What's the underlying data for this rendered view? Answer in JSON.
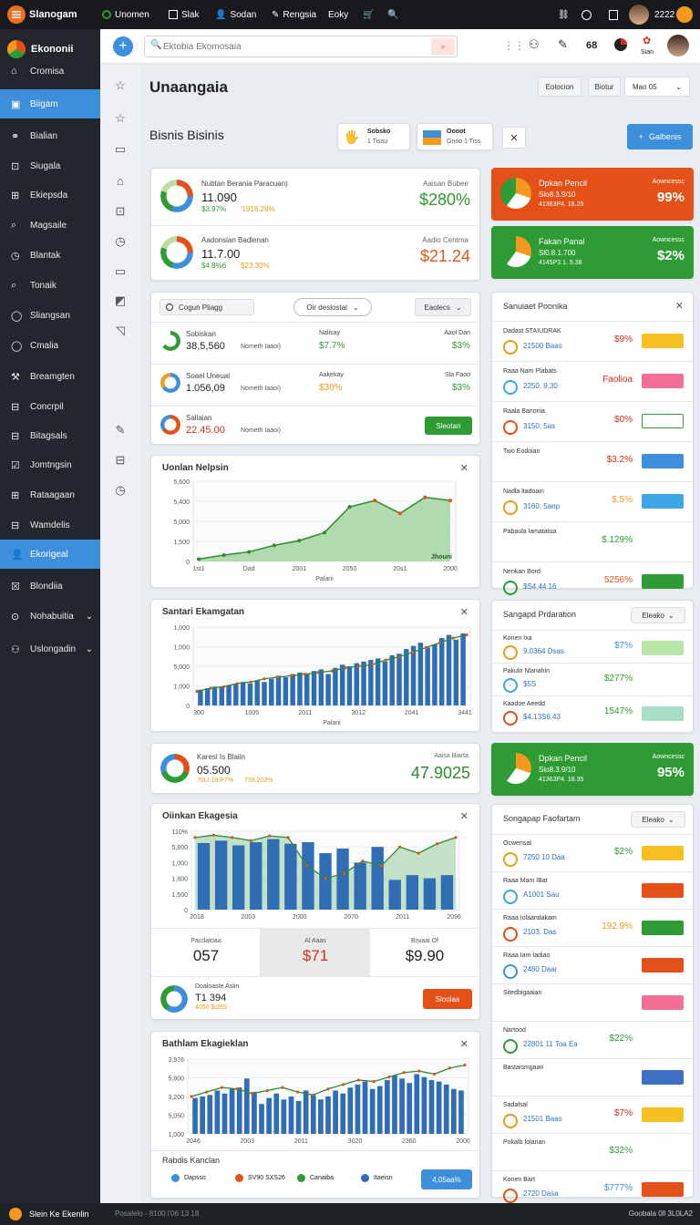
{
  "topbar": {
    "app": "Slanogam",
    "items": [
      "Unomen",
      "Slak",
      "Sodan",
      "Rengsia",
      "Eoky"
    ],
    "time": "2222"
  },
  "sidebar": {
    "brand": "Ekononii",
    "items": [
      "Cromisa",
      "Biigam",
      "Bialian",
      "Siugala",
      "Ekiepsda",
      "Magsaile",
      "Blantak",
      "Tonaik",
      "Sliangsan",
      "Cmalia",
      "Breamgten",
      "Concrpil",
      "Bitagsals",
      "Jomtngsin",
      "Rataagaan",
      "Wamdelis",
      "Ekorigeal",
      "Blondiia",
      "Nohabuitia",
      "Uslongadin"
    ]
  },
  "toolbar": {
    "search_placeholder": "Ektobia Ekomosaia",
    "badge": "68",
    "user": "Sian"
  },
  "header": {
    "title": "Unaangaia",
    "btn1": "Eolocion",
    "btn2": "Biotur",
    "select": "Mao 05"
  },
  "business": {
    "title": "Bisnis Bisinis",
    "chip1_title": "Sobsko",
    "chip1_sub": "1 Tissu",
    "chip2_title": "Oooot",
    "chip2_sub": "Gnoo 1 Tiss",
    "action": "Galbenis"
  },
  "stats": [
    {
      "title": "Nubtan Berania Paracuan)",
      "value": "11.090",
      "sub": "$3.97%",
      "sub2": "'1918.28%",
      "right_label": "Aaisan Bubee",
      "right_value": "$280%",
      "right_color": "#2e9b2e"
    },
    {
      "title": "Aadonsian Badlenan",
      "value": "11.7.00",
      "sub": "$4.8%6",
      "sub2": "$23.30%",
      "right_label": "Aadio Centma",
      "right_value": "$21.24",
      "right_color": "#e3581c"
    }
  ],
  "promo": [
    {
      "title": "Dpkan Pencil",
      "l2": "Slo8.3.9/10",
      "l3": "41363P4. 18.25",
      "label": "Aowncessc",
      "value": "99%",
      "color": "#e35018"
    },
    {
      "title": "Fakan Panal",
      "l2": "Sl0.8.1.700",
      "l3": "4145P3 1. 5.38",
      "label": "Aowncessc",
      "value": "$2%",
      "color": "#2e9b34"
    },
    {
      "title": "Dpkan Pencil",
      "l2": "Slo8.3.9/10",
      "l3": "41363P4. 18.35",
      "label": "Aowncessc",
      "value": "95%",
      "color": "#2e9b34"
    }
  ],
  "filters": {
    "search": "Cogun Pliagg",
    "select": "Oir deslostal",
    "btn": "Eaolecs"
  },
  "list1": [
    {
      "title": "Sobiskan",
      "value": "38,5,560",
      "mid": "Nometh Iaaoi)",
      "lab": "Nalisay",
      "v2": "$7.7%",
      "v2c": "#2e9b2e",
      "rl": "Aaol Dan",
      "rv": "$3%",
      "rc": "#2e9b2e"
    },
    {
      "title": "Soael Uneual",
      "value": "1.056,09",
      "mid": "Nometh Iaaoi)",
      "lab": "Aakekay",
      "v2": "$30%",
      "v2c": "#e89b16",
      "rl": "Sla Faoo",
      "rv": "$3%",
      "rc": "#2e9b2e"
    },
    {
      "title": "Sallaian",
      "value": "22.45.00",
      "mid": "Nometh Iaaoi)",
      "btn": "Sleotan"
    }
  ],
  "chart_data": [
    {
      "type": "area",
      "title": "Uonlan Nelpsin",
      "xlabel": "Palani",
      "ylabel": "",
      "x": [
        "1st1",
        "Dad",
        "2001",
        "2050",
        "20s1",
        "2000"
      ],
      "yticks": [
        "5,600",
        "5,400",
        "5,000",
        "1,500",
        "0"
      ],
      "values": [
        3,
        8,
        12,
        20,
        26,
        36,
        68,
        76,
        60,
        80,
        76
      ],
      "annotation": "Jhouni"
    },
    {
      "type": "bar",
      "title": "Santari Ekamgatan",
      "xlabel": "Palani",
      "ylabel": "",
      "x": [
        "300",
        "1005",
        "2011",
        "3012",
        "2041",
        "3441"
      ],
      "yticks": [
        "1,000",
        "1,000",
        "5,000",
        "1,000",
        "0"
      ],
      "values": [
        20,
        22,
        24,
        24,
        26,
        28,
        30,
        28,
        32,
        30,
        34,
        38,
        36,
        40,
        42,
        40,
        44,
        46,
        40,
        48,
        52,
        50,
        54,
        56,
        58,
        60,
        56,
        64,
        66,
        72,
        76,
        80,
        74,
        78,
        86,
        90,
        84,
        92
      ],
      "line": [
        18,
        22,
        24,
        28,
        30,
        34,
        36,
        38,
        40,
        42,
        44,
        48,
        50,
        52,
        58,
        62,
        68,
        74,
        80,
        86,
        90
      ]
    },
    {
      "type": "bar",
      "title": "Oiinkan Ekagesia",
      "xlabel": "",
      "ylabel": "",
      "x": [
        "2018",
        "2003",
        "2000",
        "2070",
        "2011",
        "2096"
      ],
      "yticks": [
        "110%",
        "5,800",
        "1,000",
        "1,800",
        "1,500",
        "0"
      ],
      "values": [
        85,
        88,
        82,
        86,
        90,
        84,
        86,
        72,
        78,
        60,
        80,
        38,
        44,
        40,
        44
      ],
      "line": [
        92,
        95,
        92,
        88,
        94,
        92,
        56,
        40,
        46,
        62,
        56,
        80,
        72,
        84,
        92
      ]
    },
    {
      "type": "bar",
      "title": "Bathlam Ekagieklan",
      "xlabel": "",
      "ylabel": "",
      "x": [
        "2046",
        "2003",
        "2011",
        "3020",
        "2360",
        "2000"
      ],
      "yticks": [
        "3,976",
        "5,800",
        "3,200",
        "5,050",
        "1,000"
      ],
      "values": [
        48,
        50,
        52,
        58,
        54,
        60,
        62,
        74,
        56,
        40,
        48,
        54,
        46,
        50,
        44,
        58,
        52,
        46,
        50,
        58,
        54,
        62,
        66,
        70,
        60,
        64,
        72,
        78,
        74,
        68,
        80,
        76,
        72,
        70,
        66,
        60,
        58
      ],
      "line": [
        50,
        56,
        62,
        60,
        54,
        58,
        62,
        56,
        52,
        60,
        66,
        72,
        70,
        76,
        82,
        84,
        80,
        88,
        92
      ]
    }
  ],
  "metric_single": {
    "title": "Karesl Is Blaiin",
    "value": "05.500",
    "sub": "70LI 18.P7%",
    "sub2": "739.202%",
    "right_label": "Aaisa Biarta",
    "right_value": "47.9025"
  },
  "kpis": [
    {
      "label": "Pacdatoaa",
      "value": "057",
      "color": "#222"
    },
    {
      "label": "Al Aaas",
      "value": "$71",
      "color": "#d92b1c"
    },
    {
      "label": "Bisiaai Of",
      "value": "$9.90",
      "color": "#222"
    }
  ],
  "kpi_footer": {
    "title": "Doaloaste Asiin",
    "value": "T1 394",
    "sub": "4050 $i28S",
    "btn": "Sloolaa"
  },
  "legend": {
    "title": "Rabdis Kanclan",
    "items": [
      "Dapsso",
      "SV90 SXS26",
      "Canaiba",
      "Itaeisn"
    ],
    "btn": "4,05aa%"
  },
  "panel1": {
    "title": "Sanuiaet Poonika",
    "rows": [
      {
        "t": "Dadast STAIUDRAK",
        "s": "21500 Baas",
        "v": "$9%",
        "vc": "#d92b1c",
        "pill": "#f5c021"
      },
      {
        "t": "Raaa  Nam Plabats",
        "s": "2250. 9.30",
        "v": "Faolioa",
        "vc": "#d92b1c",
        "pill": "#f26f95"
      },
      {
        "t": "Raala Banonia",
        "s": "3150. 5as",
        "v": "$0%",
        "vc": "#d92b1c",
        "pill": "#ffffff"
      },
      {
        "t": "Two Eodoian",
        "s": "",
        "v": "$3.2%",
        "vc": "#d92b1c",
        "pill": "#3d8fdc"
      },
      {
        "t": "Nadla  ltadoain",
        "s": "3160. 5anp",
        "v": "$,5%",
        "vc": "#e89b16",
        "pill": "#3da7e5"
      },
      {
        "t": "Pabaula lamatatua",
        "s": "",
        "v": "$.129%",
        "vc": "#2e9b2e",
        "pill": ""
      },
      {
        "t": "Nenkan Bord",
        "s": "$S4.44 16",
        "v": "5256%",
        "vc": "#e35018",
        "pill": "#2e9b34"
      }
    ]
  },
  "panel2": {
    "title": "Sangapd Prdaration",
    "select": "Eleako",
    "rows": [
      {
        "t": "Konen Ixa",
        "s": "9.0364 Dsas",
        "v": "$7%",
        "vc": "#3d8fdc",
        "pill": "#b7e6a6"
      },
      {
        "t": "Pakulo Nlanahin",
        "s": "$5S",
        "v": "$277%",
        "vc": "#2e9b2e",
        "pill": ""
      },
      {
        "t": "Kaadoe Aeedd",
        "s": "$4.13S6.43",
        "v": "1547%",
        "vc": "#2e9b2e",
        "pill": "#a7dec5"
      }
    ]
  },
  "panel3": {
    "title": "Songapap Faofartam",
    "select": "Eleako",
    "rows": [
      {
        "t": "Ocwensat",
        "s": "7250 10 Daa",
        "v": "$2%",
        "vc": "#2e9b2e",
        "pill": "#f5c021"
      },
      {
        "t": "Raaa  Mam IBat",
        "s": "A1001 Sau",
        "v": "",
        "vc": "#2e9b2e",
        "pill": "#e35018"
      },
      {
        "t": "Raaa  Iolaandakam",
        "s": "2103. Das",
        "v": "192.9%",
        "vc": "#e89b16",
        "pill": "#2e9b34"
      },
      {
        "t": "Raaa  Iam Iadiao",
        "s": "2480 Daar",
        "v": "",
        "vc": "#2e9b2e",
        "pill": "#e35018"
      },
      {
        "t": "Sitedbigaaian",
        "s": "",
        "v": "",
        "vc": "#2e9b2e",
        "pill": "#f26f95"
      },
      {
        "t": "Nartood",
        "s": "22801 11 Toa Ea",
        "v": "$22%",
        "vc": "#2e9b2e",
        "pill": ""
      },
      {
        "t": "Bastaismgaan",
        "s": "",
        "v": "",
        "vc": "#2e9b2e",
        "pill": "#3d6fc4"
      },
      {
        "t": "Sadalsal",
        "s": "21501 Baas",
        "v": "$7%",
        "vc": "#d92b1c",
        "pill": "#f5c021"
      },
      {
        "t": "Pokalb Iolanan",
        "s": "",
        "v": "$32%",
        "vc": "#2e9b2e",
        "pill": ""
      },
      {
        "t": "Konen Bart",
        "s": "2720 Dasa",
        "v": "$777%",
        "vc": "#3d8fdc",
        "pill": "#e35018"
      }
    ]
  },
  "status": {
    "left": "Slein Ke Ekenlin",
    "mid": "Posalelo - 8100 l'06 13 18",
    "right": "Goobala  0ll 3L0LA2"
  },
  "colors": {
    "accent": "#3d8fdc",
    "green": "#2e9b34",
    "orange": "#e35018",
    "chart_fill": "#9fd39a",
    "bar": "#2f6db5"
  }
}
